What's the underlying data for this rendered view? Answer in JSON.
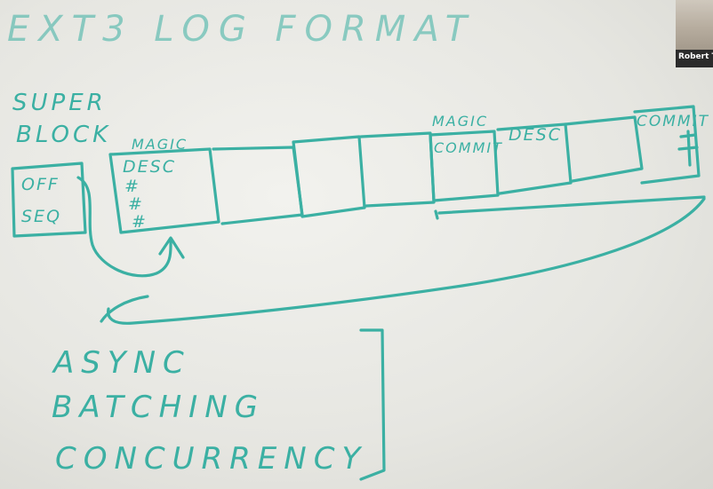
{
  "whiteboard": {
    "title": "EXT3 LOG FORMAT",
    "super_block_line1": "SUPER",
    "super_block_line2": "BLOCK",
    "field_off": "OFF",
    "field_seq": "SEQ",
    "desc_magic": "MAGIC",
    "desc_label": "DESC",
    "commit1_magic": "MAGIC",
    "commit1_label": "COMMIT",
    "desc2_label": "DESC",
    "commit2_label": "COMMIT",
    "hash_mark": "#",
    "list_items": [
      "ASYNC",
      "BATCHING",
      "CONCURRENCY"
    ]
  },
  "video": {
    "participant_name": "Robert T"
  },
  "colors": {
    "marker_ink": "#3bb0a3",
    "board": "#ecece7"
  }
}
